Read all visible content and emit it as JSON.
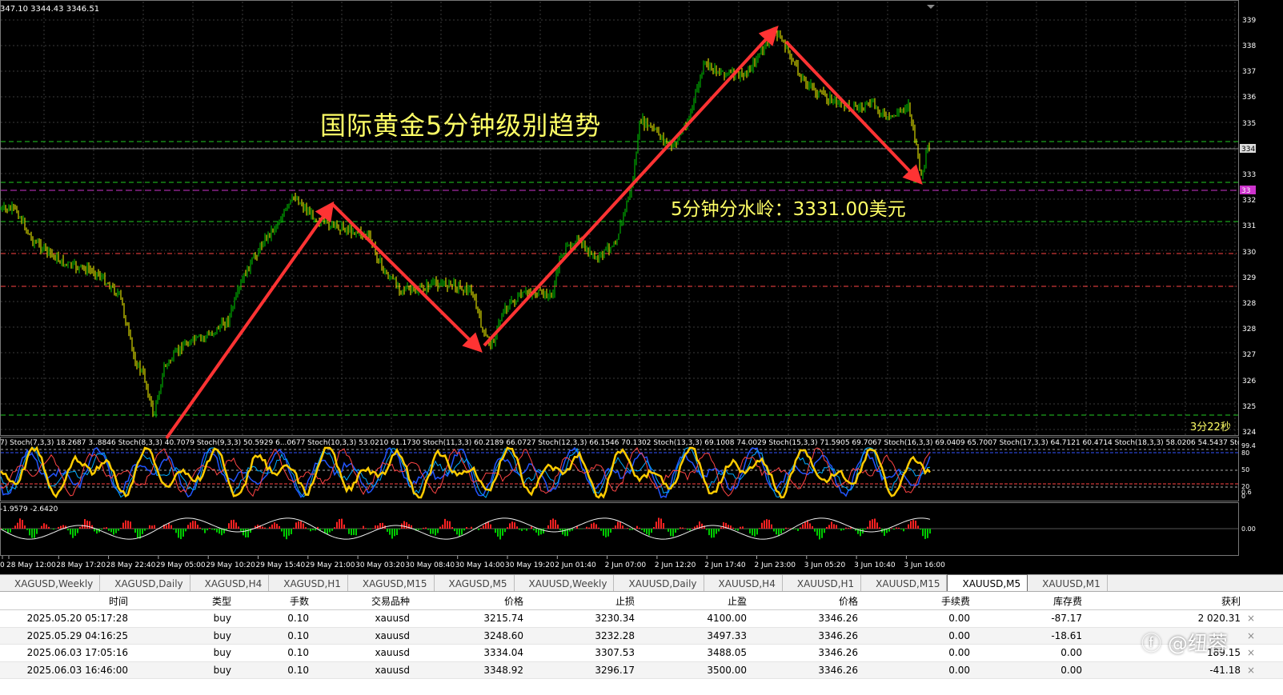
{
  "chart": {
    "ohlc": "347.10 3344.43 3346.51",
    "title_annotation": "国际黄金5分钟级别趋势",
    "level_annotation": "5分钟分水岭：3331.00美元",
    "timer": "3分22秒",
    "price_axis": {
      "labels": [
        "339",
        "338",
        "337",
        "336",
        "335",
        "334",
        "333",
        "332",
        "331",
        "330",
        "329",
        "328",
        "328",
        "327",
        "326",
        "325",
        "324"
      ],
      "current_price_tag": "334",
      "level_tag": "33"
    },
    "time_axis": [
      "0",
      "28 May 12:00",
      "28 May 17:20",
      "28 May 22:40",
      "29 May 05:00",
      "29 May 10:20",
      "29 May 15:40",
      "29 May 21:00",
      "30 May 03:20",
      "30 May 08:40",
      "30 May 14:00",
      "30 May 19:20",
      "2 Jun 01:40",
      "2 Jun 07:00",
      "2 Jun 12:20",
      "2 Jun 17:40",
      "2 Jun 23:00",
      "3 Jun 05:20",
      "3 Jun 10:40",
      "3 Jun 16:00"
    ],
    "stoch_label": "7) Stoch(7,3,3) 18.2687 3..8846 Stoch(8,3,3) 40.7079 Stoch(9,3,3) 50.5929 6...0677 Stoch(10,3,3) 53.0210 61.1730 Stoch(11,3,3) 60.2189 66.0727 Stoch(12,3,3) 66.1546 70.1302 Stoch(13,3,3) 69.1008 74.0029 Stoch(15,3,3) 71.5905 69.7067 Stoch(16,3,3) 69.0409 65.7007 Stoch(17,3,3) 64.7121 60.4714 Stoch(18,3,3) 58.0206 54.5437 Stoch(19,3,3) 51.7807 49.5444",
    "stoch_axis": [
      "99.4",
      "80",
      "50",
      "20",
      "0.6",
      "0"
    ],
    "macd_label": "-1.9579 -2.6420",
    "macd_axis": "0.00"
  },
  "tabs": [
    {
      "label": "XAGUSD,Weekly",
      "active": false
    },
    {
      "label": "XAGUSD,Daily",
      "active": false
    },
    {
      "label": "XAGUSD,H4",
      "active": false
    },
    {
      "label": "XAGUSD,H1",
      "active": false
    },
    {
      "label": "XAGUSD,M15",
      "active": false
    },
    {
      "label": "XAGUSD,M5",
      "active": false
    },
    {
      "label": "XAUUSD,Weekly",
      "active": false
    },
    {
      "label": "XAUUSD,Daily",
      "active": false
    },
    {
      "label": "XAUUSD,H4",
      "active": false
    },
    {
      "label": "XAUUSD,H1",
      "active": false
    },
    {
      "label": "XAUUSD,M15",
      "active": false
    },
    {
      "label": "XAUUSD,M5",
      "active": true
    },
    {
      "label": "XAUUSD,M1",
      "active": false
    }
  ],
  "orders": {
    "headers": [
      "时间",
      "类型",
      "手数",
      "交易品种",
      "价格",
      "止损",
      "止盈",
      "价格",
      "手续费",
      "库存费",
      "获利"
    ],
    "rows": [
      [
        "2025.05.20 05:17:28",
        "buy",
        "0.10",
        "xauusd",
        "3215.74",
        "3230.34",
        "4100.00",
        "3346.26",
        "0.00",
        "-87.17",
        "2 020.31"
      ],
      [
        "2025.05.29 04:16:25",
        "buy",
        "0.10",
        "xauusd",
        "3248.60",
        "3232.28",
        "3497.33",
        "3346.26",
        "0.00",
        "-18.61",
        ""
      ],
      [
        "2025.06.03 17:05:16",
        "buy",
        "0.10",
        "xauusd",
        "3334.04",
        "3307.53",
        "3488.05",
        "3346.26",
        "0.00",
        "0.00",
        "189.15"
      ],
      [
        "2025.06.03 16:46:00",
        "buy",
        "0.10",
        "xauusd",
        "3348.92",
        "3296.17",
        "3500.00",
        "3346.26",
        "0.00",
        "0.00",
        "-41.18"
      ]
    ],
    "close_symbol": "×"
  },
  "watermark": "ⓕ @纽蓉",
  "colors": {
    "background": "#000000",
    "bull_candle": "#00cc00",
    "bear_candle": "#ffff00",
    "arrow": "#ff3333",
    "dashed_green": "#22cc22",
    "dashed_red": "#ff4444",
    "magenta_level": "#cc33cc",
    "annotation_yellow": "#ffff66",
    "stoch_yellow": "#ffcc00"
  }
}
